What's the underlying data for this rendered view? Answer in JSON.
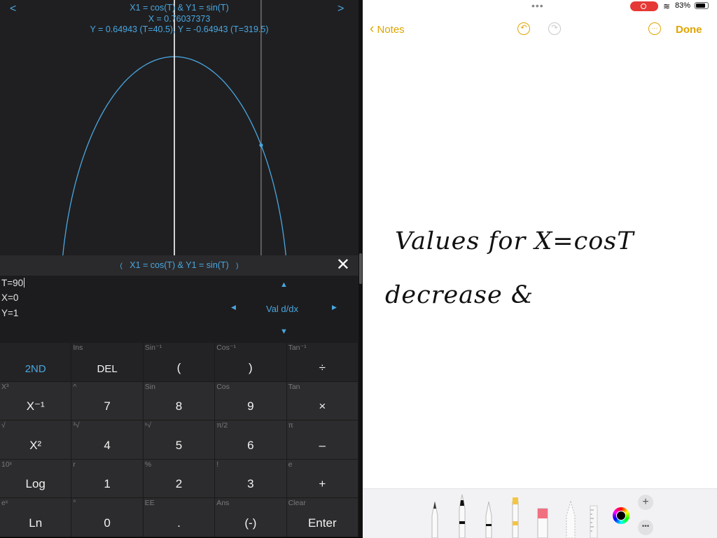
{
  "calculator": {
    "graph_header": {
      "line1": "X1 = cos(T) & Y1 = sin(T)",
      "line2": "X = 0.76037373",
      "line3": "Y = 0.64943 (T=40.5), Y = -0.64943 (T=319.5)",
      "nav_prev": "<",
      "nav_next": ">"
    },
    "curve": {
      "x_range": [
        -1,
        1
      ],
      "y_range": [
        -1,
        1
      ],
      "traced_x": 0.76037373,
      "traced_y": 0.64943
    },
    "function_bar": {
      "label": "X1 = cos(T) & Y1 = sin(T)",
      "left_mark": "(",
      "right_mark": ")",
      "close": "✕"
    },
    "readout": {
      "t": "T=90",
      "x": "X=0",
      "y": "Y=1",
      "mode": "Val d/dx"
    },
    "keys": [
      {
        "sec": "",
        "main": "2ND",
        "style": "blue"
      },
      {
        "sec": "Ins",
        "main": "DEL",
        "style": "small"
      },
      {
        "sec": "Sin⁻¹",
        "main": "(",
        "style": ""
      },
      {
        "sec": "Cos⁻¹",
        "main": ")",
        "style": ""
      },
      {
        "sec": "Tan⁻¹",
        "main": "÷",
        "style": ""
      },
      {
        "sec": "X³",
        "main": "X⁻¹",
        "style": ""
      },
      {
        "sec": "^",
        "main": "7",
        "style": ""
      },
      {
        "sec": "Sin",
        "main": "8",
        "style": ""
      },
      {
        "sec": "Cos",
        "main": "9",
        "style": ""
      },
      {
        "sec": "Tan",
        "main": "×",
        "style": ""
      },
      {
        "sec": "√",
        "main": "X²",
        "style": ""
      },
      {
        "sec": "³√",
        "main": "4",
        "style": ""
      },
      {
        "sec": "ˣ√",
        "main": "5",
        "style": ""
      },
      {
        "sec": "π/2",
        "main": "6",
        "style": ""
      },
      {
        "sec": "π",
        "main": "–",
        "style": ""
      },
      {
        "sec": "10ˣ",
        "main": "Log",
        "style": ""
      },
      {
        "sec": "r",
        "main": "1",
        "style": ""
      },
      {
        "sec": "%",
        "main": "2",
        "style": ""
      },
      {
        "sec": "!",
        "main": "3",
        "style": ""
      },
      {
        "sec": "e",
        "main": "+",
        "style": ""
      },
      {
        "sec": "eˣ",
        "main": "Ln",
        "style": ""
      },
      {
        "sec": "°",
        "main": "0",
        "style": ""
      },
      {
        "sec": "EE",
        "main": ".",
        "style": ""
      },
      {
        "sec": "Ans",
        "main": "(-)",
        "style": ""
      },
      {
        "sec": "Clear",
        "main": "Enter",
        "style": ""
      }
    ],
    "accent_color": "#4aa6e0"
  },
  "notes": {
    "status": {
      "battery": "83%",
      "battery_level": 0.83
    },
    "nav": {
      "back_label": "Notes",
      "done_label": "Done"
    },
    "handwriting": {
      "line1": "Values  for  X=cosT",
      "line2": "decrease  &"
    },
    "accent_color": "#e0a400"
  }
}
